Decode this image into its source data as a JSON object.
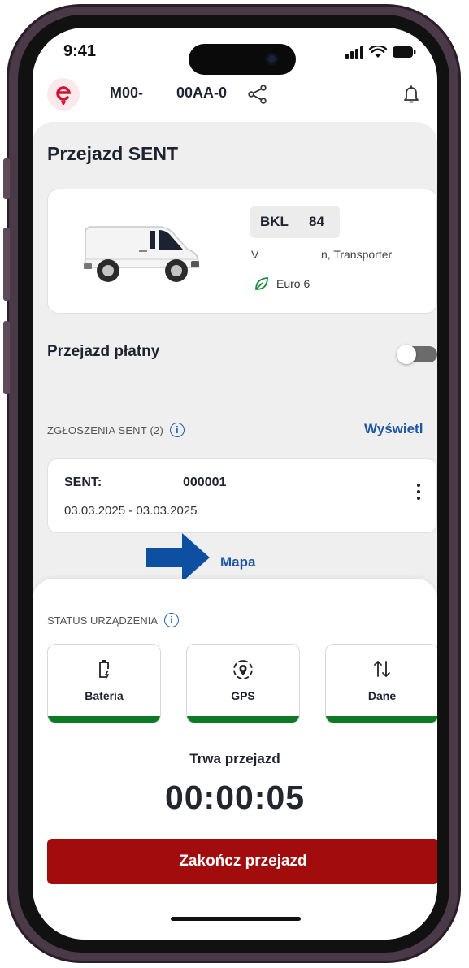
{
  "status_bar": {
    "time": "9:41",
    "icons": [
      "signal-icon",
      "wifi-icon",
      "battery-icon"
    ]
  },
  "header": {
    "logo_icon": "e-logo-icon",
    "plate_part1": "M00-",
    "plate_part2": "00AA-0",
    "share_icon": "share-icon",
    "bell_icon": "bell-icon"
  },
  "page": {
    "title": "Przejazd SENT"
  },
  "vehicle": {
    "image": "van-image",
    "plate_part1": "BKL",
    "plate_part2": "84",
    "model_part1": "V",
    "model_part2": "n, Transporter",
    "emission": "Euro 6",
    "emission_icon": "leaf-icon"
  },
  "paid_trip": {
    "label": "Przejazd płatny",
    "enabled": false
  },
  "sent_section": {
    "label": "ZGŁOSZENIA SENT (2)",
    "view_link": "Wyświetl",
    "item": {
      "id_part1": "SENT:",
      "id_part2": "000001",
      "dates": "03.03.2025 - 03.03.2025"
    },
    "map_link": "Mapa"
  },
  "device_status": {
    "label": "STATUS URZĄDZENIA",
    "tiles": [
      {
        "label": "Bateria",
        "icon": "battery-charging-icon"
      },
      {
        "label": "GPS",
        "icon": "gps-icon"
      },
      {
        "label": "Dane",
        "icon": "data-transfer-icon"
      }
    ]
  },
  "trip": {
    "label": "Trwa przejazd",
    "timer": "00:00:05",
    "end_button": "Zakończ przejazd"
  },
  "colors": {
    "accent_red": "#a30c0c",
    "link_blue": "#1f57a4",
    "status_green": "#0d7a25",
    "arrow_blue": "#0d4fa0"
  }
}
